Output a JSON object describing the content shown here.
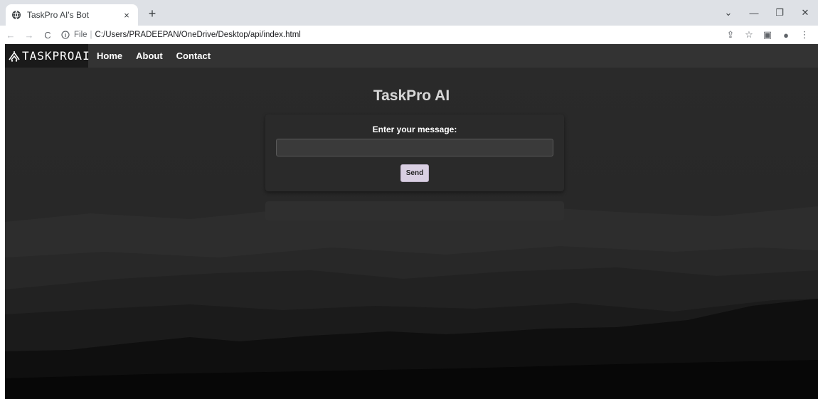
{
  "browser": {
    "tab_title": "TaskPro AI's Bot",
    "tab_close": "×",
    "new_tab": "+",
    "window_controls": {
      "minimize": "—",
      "restore": "❐",
      "close": "✕",
      "tab_search": "⌄"
    },
    "nav": {
      "back": "←",
      "forward": "→",
      "reload": "C"
    },
    "address": {
      "scheme": "File",
      "separator": "|",
      "url": "C:/Users/PRADEEPAN/OneDrive/Desktop/api/index.html"
    },
    "toolbar_icons": {
      "share": "⇪",
      "bookmark": "☆",
      "side_panel": "▣",
      "profile": "●",
      "menu": "⋮"
    }
  },
  "page": {
    "brand": {
      "text": "TASKPROAI",
      "icon": "stylized-logo-icon"
    },
    "nav_links": [
      "Home",
      "About",
      "Contact"
    ],
    "title": "TaskPro AI",
    "form": {
      "label": "Enter your message:",
      "input_value": "",
      "input_placeholder": "",
      "send_label": "Send"
    },
    "response": ""
  },
  "colors": {
    "navbar": "#333333",
    "brand_bg": "#1a1a1a",
    "page_bg": "#2b2b2b",
    "send_button": "#d9cfe2",
    "title_text": "#d7d7d7"
  }
}
